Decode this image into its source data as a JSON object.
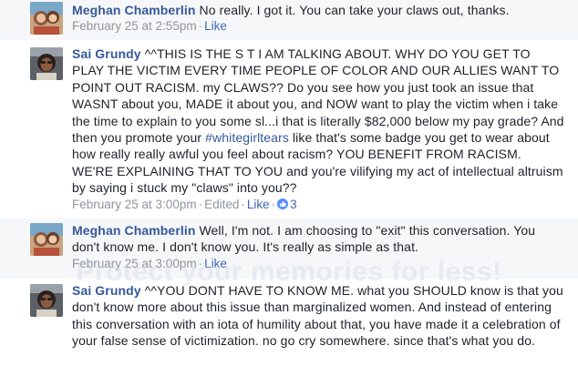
{
  "comments": [
    {
      "author": "Meghan Chamberlin",
      "text": " No really. I got it. You can take your claws out, thanks.",
      "timestamp": "February 25 at 2:55pm",
      "like_label": "Like"
    },
    {
      "author": "Sai Grundy",
      "text_before_hashtag": " ^^THIS IS THE S    T I AM TALKING ABOUT. WHY DO YOU GET TO PLAY THE VICTIM EVERY TIME PEOPLE OF COLOR AND OUR ALLIES WANT TO POINT OUT RACISM. my CLAWS?? Do you see how you just took an issue that WASNT about you, MADE it about you, and NOW want to play the victim when i take the time to explain to you some sl...i that is literally $82,000 below my pay grade? And then you promote your ",
      "hashtag": "#whitegirltears",
      "text_after_hashtag": " like that's some badge you get to wear about how really really awful you feel about racism? YOU BENEFIT FROM RACISM. WE'RE EXPLAINING THAT TO YOU and you're vilifying my act of intellectual altruism by saying i stuck my \"claws\" into you??",
      "timestamp": "February 25 at 3:00pm",
      "edited_label": "Edited",
      "like_label": "Like",
      "like_count": "3"
    },
    {
      "author": "Meghan Chamberlin",
      "text": " Well, I'm not. I am choosing to \"exit\" this conversation. You don't know me. I don't know you. It's really as simple as that.",
      "timestamp": "February 25 at 3:00pm",
      "like_label": "Like"
    },
    {
      "author": "Sai Grundy",
      "text": " ^^YOU DONT HAVE TO KNOW ME. what you SHOULD know is that you don't know more about this issue than marginalized women. And instead of entering this conversation with an iota of humility about that, you have made it a celebration of your false sense of victimization. no go cry somewhere. since that's what you do."
    }
  ],
  "watermark": "Protect your memories for less!",
  "separator": "·",
  "colors": {
    "link": "#365899",
    "meta": "#90949c",
    "text": "#1d2129",
    "like_blue": "#5890ff"
  },
  "icons": {
    "like": "thumbs-up-icon"
  }
}
